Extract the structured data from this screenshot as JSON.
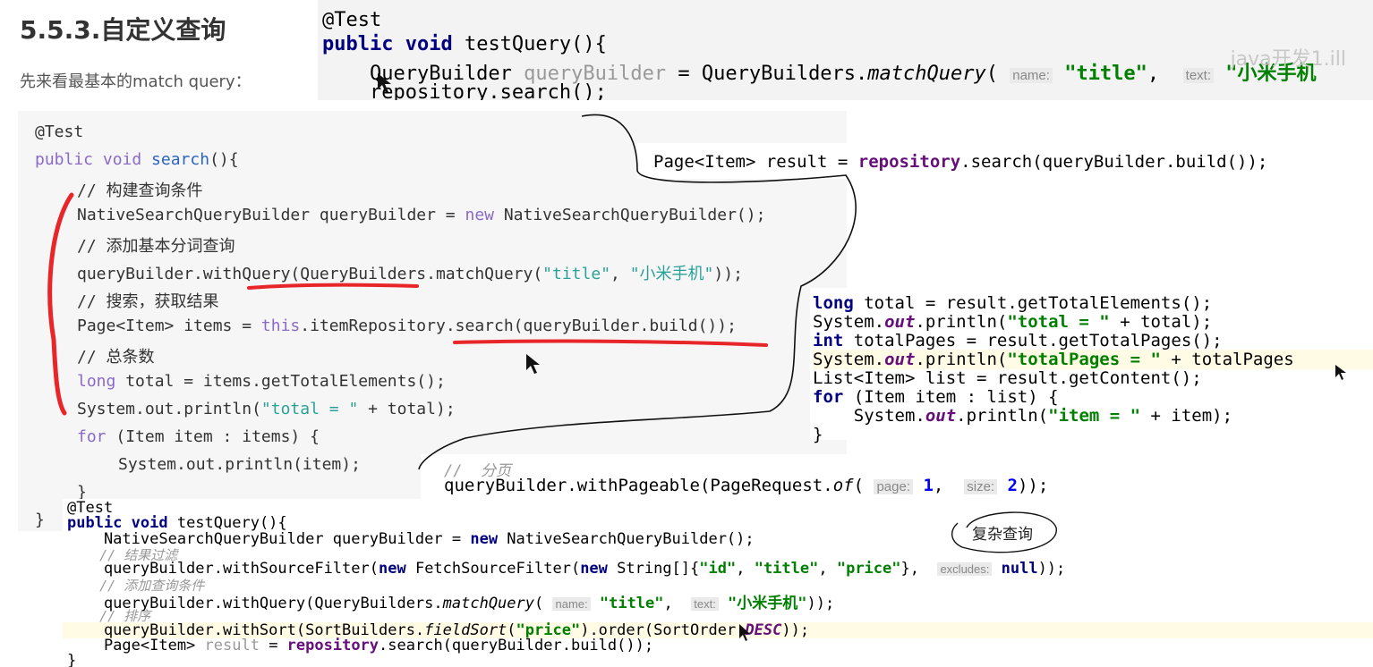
{
  "doc": {
    "heading": "5.5.3.自定义查询",
    "intro": "先来看最基本的match query："
  },
  "ide_top": {
    "l1": "@Test",
    "l2_kw": "public void",
    "l2_rest": " testQuery(){",
    "l3_a": "    QueryBuilder ",
    "l3_var": "queryBuilder",
    "l3_b": " = QueryBuilders.",
    "l3_fn": "matchQuery",
    "l3_c": "( ",
    "l3_hint1": "name:",
    "l3_str1": " \"title\"",
    "l3_d": ",  ",
    "l3_hint2": "text:",
    "l3_str2": " \"小米手机",
    "l4": "    repository.search();",
    "watermark": "java开发1.ill"
  },
  "tutorial": {
    "l1": "@Test",
    "l2_kw": "public void ",
    "l2_fn": "search",
    "l2_rest": "(){",
    "l3": "// 构建查询条件",
    "l4_a": "NativeSearchQueryBuilder queryBuilder = ",
    "l4_kw": "new",
    "l4_b": " NativeSearchQueryBuilder();",
    "l5": "// 添加基本分词查询",
    "l6_a": "queryBuilder.withQuery(QueryBuilders.matchQuery(",
    "l6_s1": "\"title\"",
    "l6_b": ", ",
    "l6_s2": "\"小米手机\"",
    "l6_c": "));",
    "l7": "// 搜索，获取结果",
    "l8_a": "Page<Item> items = ",
    "l8_kw": "this",
    "l8_b": ".itemRepository.search(queryBuilder.build());",
    "l9": "// 总条数",
    "l10_kw": "long",
    "l10_b": " total = items.getTotalElements();",
    "l11_a": "System.out.println(",
    "l11_s": "\"total = \"",
    "l11_b": " + total);",
    "l12_kw": "for",
    "l12_b": " (Item item : items) {",
    "l13": "System.out.println(item);",
    "l14": "}",
    "l15": "}"
  },
  "snip_page": {
    "a": "Page<Item> result = ",
    "field": "repository",
    "b": ".search(queryBuilder.build());"
  },
  "snip_total": {
    "l1_kw": "long",
    "l1_b": " total = result.getTotalElements();",
    "l2_a": "System.",
    "l2_out": "out",
    "l2_b": ".println(",
    "l2_s": "\"total = \"",
    "l2_c": " + total);",
    "l3_kw": "int",
    "l3_b": " totalPages = result.getTotalPages();",
    "l4_a": "System.",
    "l4_out": "out",
    "l4_b": ".println(",
    "l4_s": "\"totalPages = \"",
    "l4_c": " + totalPages",
    "l5": "List<Item> list = result.getContent();",
    "l6_kw": "for",
    "l6_b": " (Item item : list) {",
    "l7_a": "    System.",
    "l7_out": "out",
    "l7_b": ".println(",
    "l7_s": "\"item = \"",
    "l7_c": " + item);",
    "l8": "}"
  },
  "snip_pager": {
    "cm": "//  分页",
    "a": "queryBuilder.withPageable(PageRequest.",
    "fn": "of",
    "b": "( ",
    "h1": "page:",
    "v1": " 1",
    "c": ",  ",
    "h2": "size:",
    "v2": " 2",
    "d": "));"
  },
  "snip_bottom": {
    "l1": "@Test",
    "l2_kw": "public void",
    "l2_b": " testQuery(){",
    "l3_a": "    NativeSearchQueryBuilder queryBuilder = ",
    "l3_kw": "new",
    "l3_b": " NativeSearchQueryBuilder();",
    "l4": "    // 结果过滤",
    "l5_a": "    queryBuilder.withSourceFilter(",
    "l5_kw1": "new",
    "l5_b": " FetchSourceFilter(",
    "l5_kw2": "new",
    "l5_c": " String[]{",
    "l5_s1": "\"id\"",
    "l5_d": ", ",
    "l5_s2": "\"title\"",
    "l5_e": ", ",
    "l5_s3": "\"price\"",
    "l5_f": "},  ",
    "l5_h": "excludes:",
    "l5_null": " null",
    "l5_g": "));",
    "l6": "    // 添加查询条件",
    "l7_a": "    queryBuilder.withQuery(QueryBuilders.",
    "l7_fn": "matchQuery",
    "l7_b": "( ",
    "l7_h1": "name:",
    "l7_s1": " \"title\"",
    "l7_c": ",  ",
    "l7_h2": "text:",
    "l7_s2": " \"小米手机\"",
    "l7_d": "));",
    "l8": "    // 排序",
    "l9_a": "    queryBuilder.withSort(SortBuilders.",
    "l9_fn": "fieldSort",
    "l9_b": "(",
    "l9_s": "\"price\"",
    "l9_c": ").order(SortOrder.",
    "l9_desc": "DESC",
    "l9_d": "));",
    "l10_a": "    Page<Item> ",
    "l10_var": "result",
    "l10_b": " = ",
    "l10_field": "repository",
    "l10_c": ".search(queryBuilder.build());",
    "l11": "}"
  },
  "note": "复杂查询"
}
